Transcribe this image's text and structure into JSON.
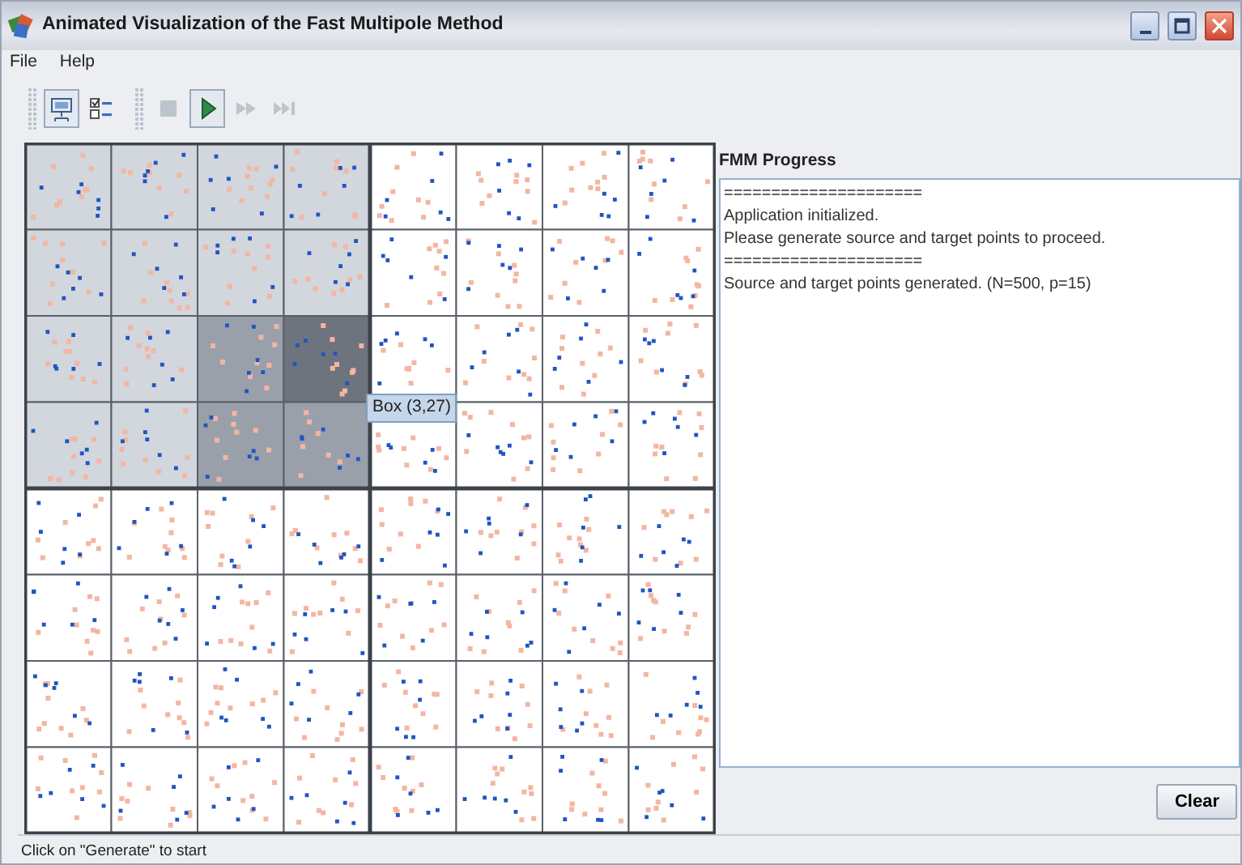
{
  "window": {
    "title": "Animated Visualization of the Fast Multipole Method"
  },
  "menu": [
    "File",
    "Help"
  ],
  "toolbar": [
    {
      "kind": "display",
      "selected": true,
      "disabled": false
    },
    {
      "kind": "checklist",
      "selected": false,
      "disabled": false
    },
    {
      "kind": "separator"
    },
    {
      "kind": "stop",
      "selected": false,
      "disabled": true
    },
    {
      "kind": "play",
      "selected": true,
      "disabled": false
    },
    {
      "kind": "forward",
      "selected": false,
      "disabled": true
    },
    {
      "kind": "end",
      "selected": false,
      "disabled": true
    }
  ],
  "grid": {
    "rows": [
      [
        {
          "color": "#d2d6dd"
        },
        {
          "color": "#d2d6dd"
        },
        {
          "color": "#d2d6dd"
        },
        {
          "color": "#d2d6dd"
        },
        {
          "color": "#ffffff"
        },
        {
          "color": "#ffffff"
        },
        {
          "color": "#ffffff"
        },
        {
          "color": "#ffffff"
        }
      ],
      [
        {
          "color": "#d2d6dd"
        },
        {
          "color": "#d2d6dd"
        },
        {
          "color": "#d2d6dd"
        },
        {
          "color": "#d2d6dd"
        },
        {
          "color": "#ffffff"
        },
        {
          "color": "#ffffff"
        },
        {
          "color": "#ffffff"
        },
        {
          "color": "#ffffff"
        }
      ],
      [
        {
          "color": "#d2d6dd"
        },
        {
          "color": "#d2d6dd"
        },
        {
          "color": "#9aa0aa"
        },
        {
          "color": "#6e747d"
        },
        {
          "color": "#ffffff"
        },
        {
          "color": "#ffffff"
        },
        {
          "color": "#ffffff"
        },
        {
          "color": "#ffffff"
        }
      ],
      [
        {
          "color": "#d2d6dd"
        },
        {
          "color": "#d2d6dd"
        },
        {
          "color": "#9aa0aa"
        },
        {
          "color": "#9aa0aa"
        },
        {
          "color": "#ffffff"
        },
        {
          "color": "#ffffff"
        },
        {
          "color": "#ffffff"
        },
        {
          "color": "#ffffff"
        }
      ],
      [
        {
          "color": "#ffffff"
        },
        {
          "color": "#ffffff"
        },
        {
          "color": "#ffffff"
        },
        {
          "color": "#ffffff"
        },
        {
          "color": "#ffffff"
        },
        {
          "color": "#ffffff"
        },
        {
          "color": "#ffffff"
        },
        {
          "color": "#ffffff"
        }
      ],
      [
        {
          "color": "#ffffff"
        },
        {
          "color": "#ffffff"
        },
        {
          "color": "#ffffff"
        },
        {
          "color": "#ffffff"
        },
        {
          "color": "#ffffff"
        },
        {
          "color": "#ffffff"
        },
        {
          "color": "#ffffff"
        },
        {
          "color": "#ffffff"
        }
      ],
      [
        {
          "color": "#ffffff"
        },
        {
          "color": "#ffffff"
        },
        {
          "color": "#ffffff"
        },
        {
          "color": "#ffffff"
        },
        {
          "color": "#ffffff"
        },
        {
          "color": "#ffffff"
        },
        {
          "color": "#ffffff"
        },
        {
          "color": "#ffffff"
        }
      ],
      [
        {
          "color": "#ffffff"
        },
        {
          "color": "#ffffff"
        },
        {
          "color": "#ffffff"
        },
        {
          "color": "#ffffff"
        },
        {
          "color": "#ffffff"
        },
        {
          "color": "#ffffff"
        },
        {
          "color": "#ffffff"
        },
        {
          "color": "#ffffff"
        }
      ]
    ],
    "tooltip": "Box (3,27)"
  },
  "progress": {
    "title": "FMM Progress",
    "lines": [
      "=====================",
      "Application initialized.",
      "Please generate source and target points to proceed.",
      "=====================",
      "Source and target points generated. (N=500, p=15)"
    ]
  },
  "clear_button": "Clear",
  "status_bar": "Click on \"Generate\" to start"
}
